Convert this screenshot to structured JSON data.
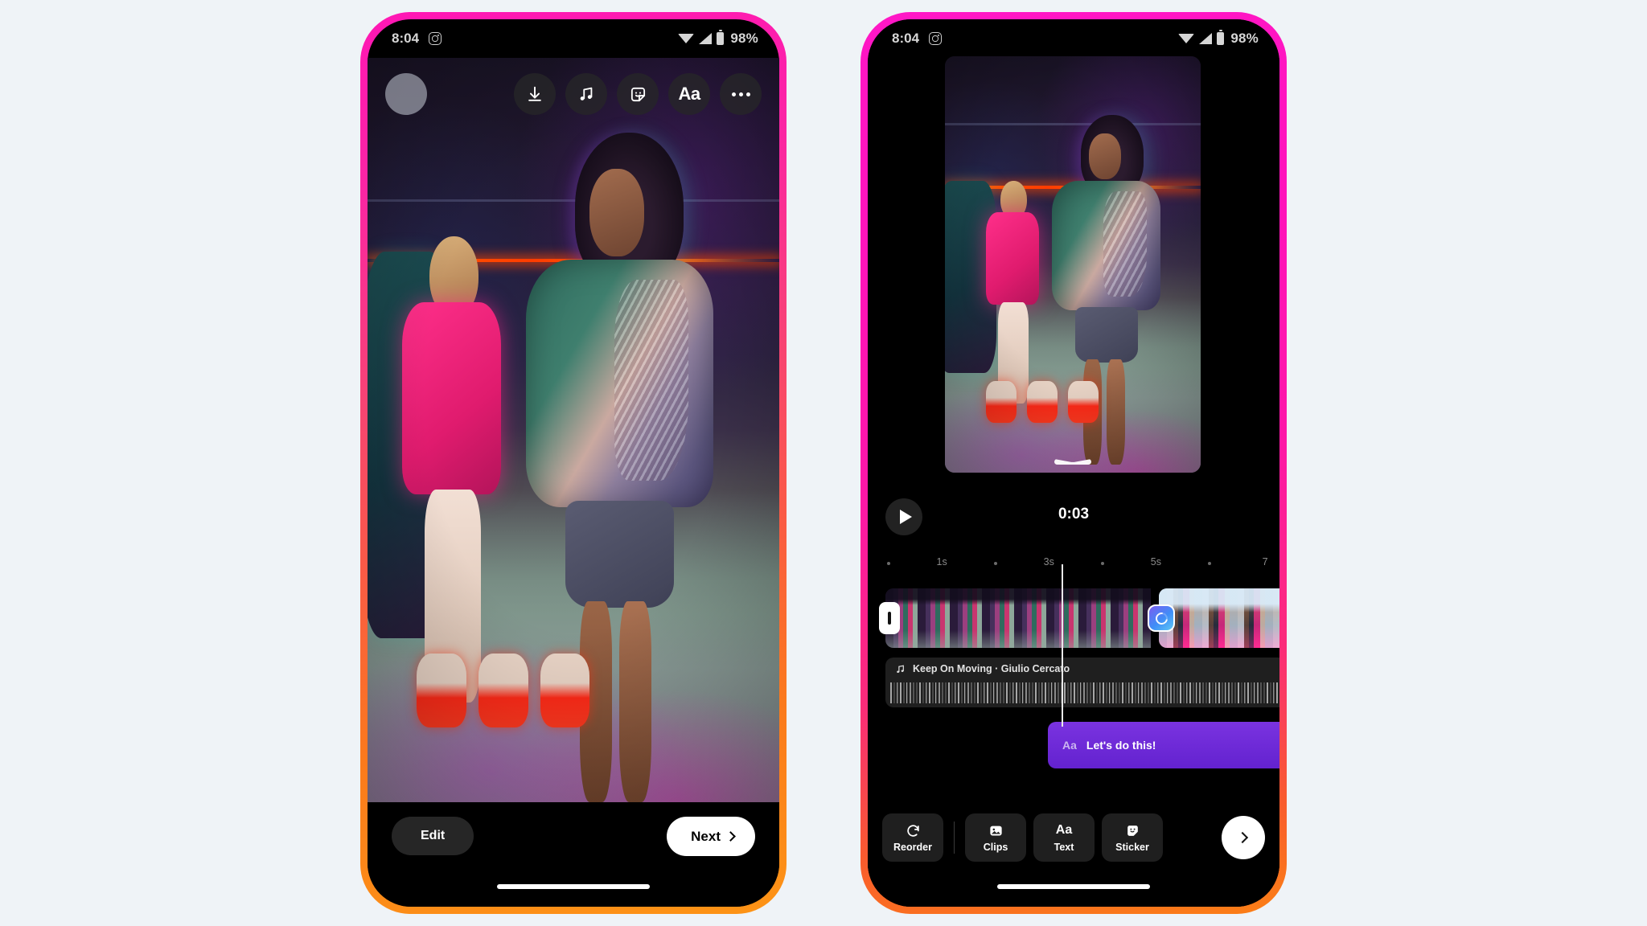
{
  "background_color": "#eff3f7",
  "phones": {
    "left": {
      "frame_gradient": [
        "#ff17b5",
        "#fb7a1c"
      ],
      "status_bar": {
        "time": "8:04",
        "app_icon": "instagram-icon",
        "wifi_icon": "wifi-icon",
        "signal_icon": "cellular-signal-icon",
        "battery_icon": "battery-icon",
        "battery_percent": "98%"
      },
      "top_toolbar": {
        "avatar": "avatar-placeholder",
        "buttons": [
          {
            "name": "download-button",
            "icon": "download-icon",
            "label": ""
          },
          {
            "name": "music-button",
            "icon": "music-note-icon",
            "label": ""
          },
          {
            "name": "sticker-button",
            "icon": "sticker-smiley-icon",
            "label": ""
          },
          {
            "name": "text-button",
            "icon": "text-aa-icon",
            "label": "Aa"
          },
          {
            "name": "more-button",
            "icon": "more-horizontal-icon",
            "label": ""
          }
        ]
      },
      "bottom_bar": {
        "edit_label": "Edit",
        "next_label": "Next",
        "next_icon": "chevron-right-icon"
      },
      "home_indicator": true
    },
    "right": {
      "frame_gradient": [
        "#ff17c6",
        "#fb7f16"
      ],
      "status_bar": {
        "time": "8:04",
        "app_icon": "instagram-icon",
        "wifi_icon": "wifi-icon",
        "signal_icon": "cellular-signal-icon",
        "battery_icon": "battery-icon",
        "battery_percent": "98%"
      },
      "preview": {
        "handle_icon": "swipe-down-handle-icon"
      },
      "transport": {
        "play_icon": "play-icon",
        "timecode": "0:03"
      },
      "ruler": {
        "ticks": [
          {
            "label": "1s",
            "pos_pct": 18
          },
          {
            "label": "3s",
            "pos_pct": 44
          },
          {
            "label": "5s",
            "pos_pct": 70
          },
          {
            "label": "7",
            "pos_pct": 96
          }
        ],
        "dots_pct": [
          5,
          31,
          57,
          83
        ],
        "playhead_pct": 47
      },
      "tracks": {
        "video": {
          "clip_a_name": "video-clip-1",
          "clip_b_name": "video-clip-2",
          "trim_handle": "trim-handle-icon",
          "transition_icon": "transition-icon"
        },
        "audio": {
          "icon": "music-note-icon",
          "title": "Keep On Moving · Giulio Cercato",
          "waveform": "audio-waveform"
        },
        "text": {
          "icon_label": "Aa",
          "label": "Let's do this!",
          "color": "#6f2bd8"
        }
      },
      "bottom_toolbar": {
        "items": [
          {
            "name": "reorder-button",
            "icon": "rotate-ccw-icon",
            "label": "Reorder"
          },
          {
            "name": "clips-button",
            "icon": "image-icon",
            "label": "Clips"
          },
          {
            "name": "text-button",
            "icon": "text-aa-icon",
            "label": "Text",
            "glyph": "Aa"
          },
          {
            "name": "sticker-button",
            "icon": "sticker-icon",
            "label": "Sticker"
          }
        ],
        "forward_icon": "chevron-right-icon"
      },
      "home_indicator": true
    }
  }
}
